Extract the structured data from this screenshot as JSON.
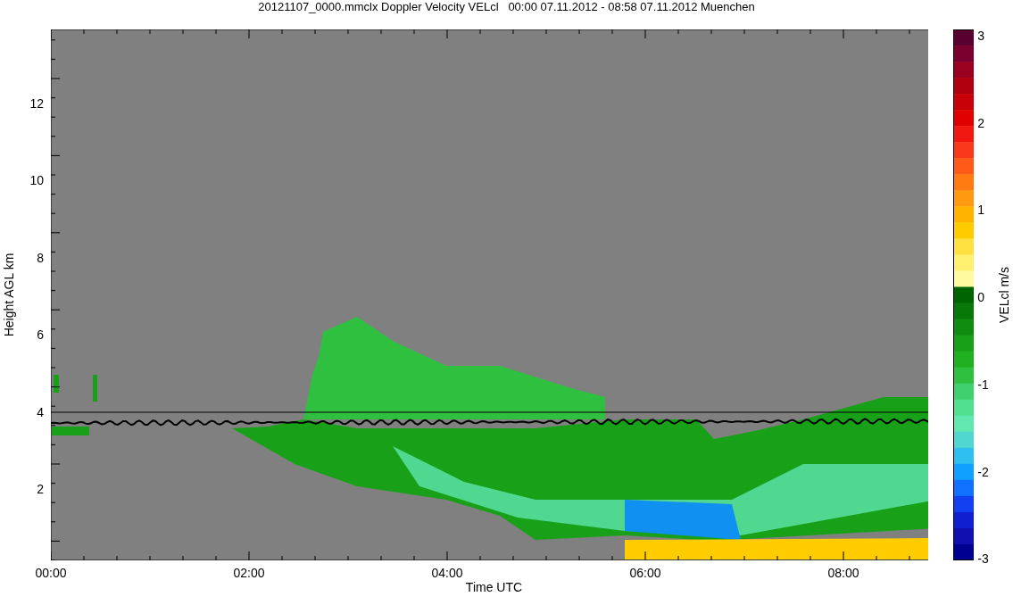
{
  "title": "20121107_0000.mmclx Doppler Velocity VELcl   00:00 07.11.2012 - 08:58 07.11.2012 Muenchen",
  "y_axis": {
    "label": "Height AGL km",
    "ticks": [
      "12",
      "10",
      "8",
      "6",
      "4",
      "2"
    ]
  },
  "x_axis": {
    "label": "Time UTC",
    "ticks": [
      "00:00",
      "02:00",
      "04:00",
      "06:00",
      "08:00"
    ]
  },
  "colorbar": {
    "label": "VELcl m/s",
    "ticks": [
      "3",
      "2",
      "1",
      "0",
      "-1",
      "-2",
      "-3"
    ]
  }
}
